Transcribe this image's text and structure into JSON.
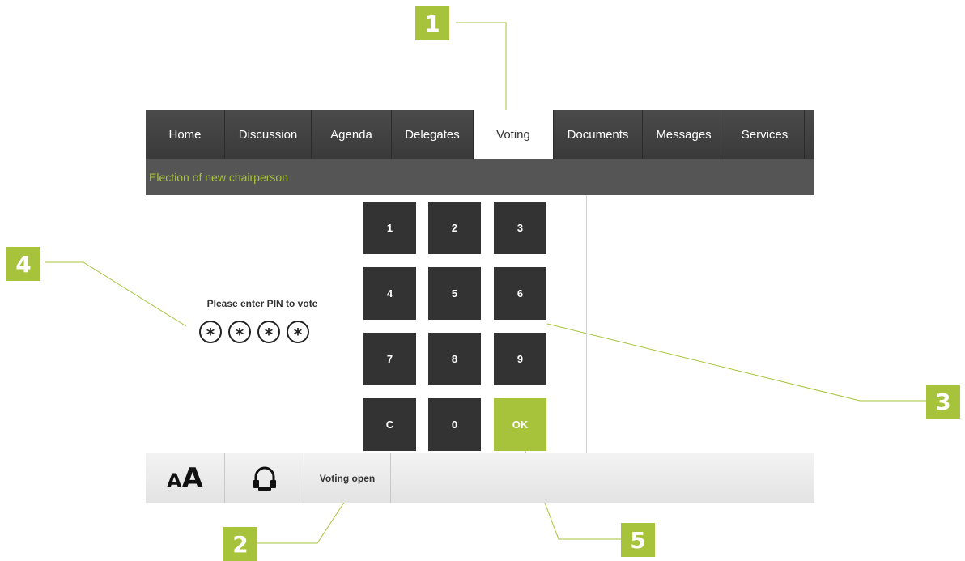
{
  "callouts": [
    "1",
    "2",
    "3",
    "4",
    "5"
  ],
  "nav": {
    "tabs": [
      {
        "label": "Home",
        "active": false
      },
      {
        "label": "Discussion",
        "active": false
      },
      {
        "label": "Agenda",
        "active": false
      },
      {
        "label": "Delegates",
        "active": false
      },
      {
        "label": "Voting",
        "active": true
      },
      {
        "label": "Documents",
        "active": false
      },
      {
        "label": "Messages",
        "active": false
      },
      {
        "label": "Services",
        "active": false
      }
    ]
  },
  "subject": "Election of new chairperson",
  "pin": {
    "prompt": "Please enter PIN to vote",
    "dots": [
      "*",
      "*",
      "*",
      "*"
    ]
  },
  "keypad": [
    "1",
    "2",
    "3",
    "4",
    "5",
    "6",
    "7",
    "8",
    "9",
    "C",
    "0",
    "OK"
  ],
  "bottom": {
    "font_size_icon_small": "A",
    "font_size_icon_big": "A",
    "headphone_icon": "headphone-icon",
    "status": "Voting open"
  },
  "colors": {
    "accent": "#a6c33b",
    "nav_bg": "#444444",
    "key_bg": "#333333"
  }
}
